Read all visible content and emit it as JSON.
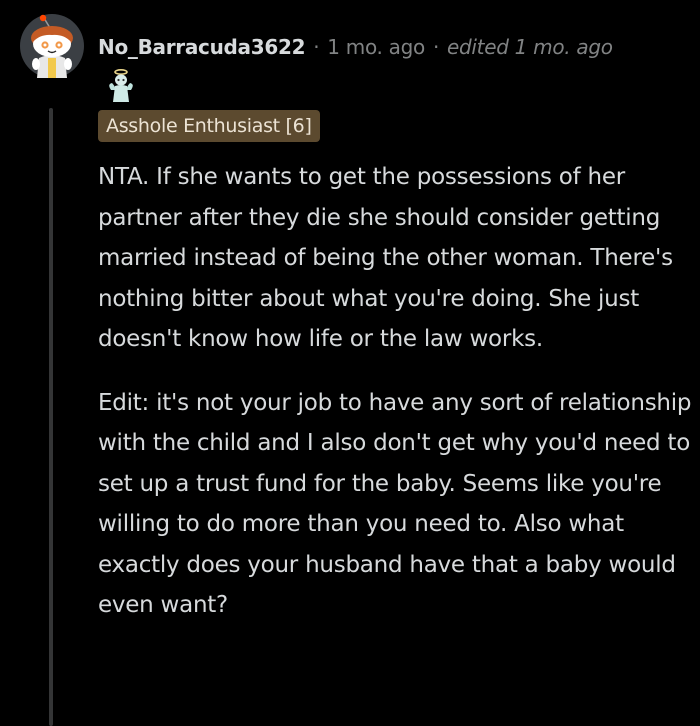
{
  "comment": {
    "author": "No_Barracuda3622",
    "separator": "·",
    "time_ago": "1 mo. ago",
    "edited": "edited 1 mo. ago",
    "award_icon": "angel-award-icon",
    "flair": "Asshole Enthusiast [6]",
    "paragraphs": [
      "NTA. If she wants to get the possessions of her partner after they die she should consider getting married instead of being the other woman. There's nothing bitter about what you're doing. She just doesn't know how life or the law works.",
      "Edit: it's not your job to have any sort of relationship with the child and I also don't get why you'd need to set up a trust fund for the baby. Seems like you're willing to do more than you need to. Also what exactly does your husband have that a baby would even want?"
    ]
  },
  "colors": {
    "background": "#000000",
    "text": "#d7dadc",
    "meta": "#818384",
    "flair_background": "#5c4a2f",
    "thread_line": "#343536"
  }
}
